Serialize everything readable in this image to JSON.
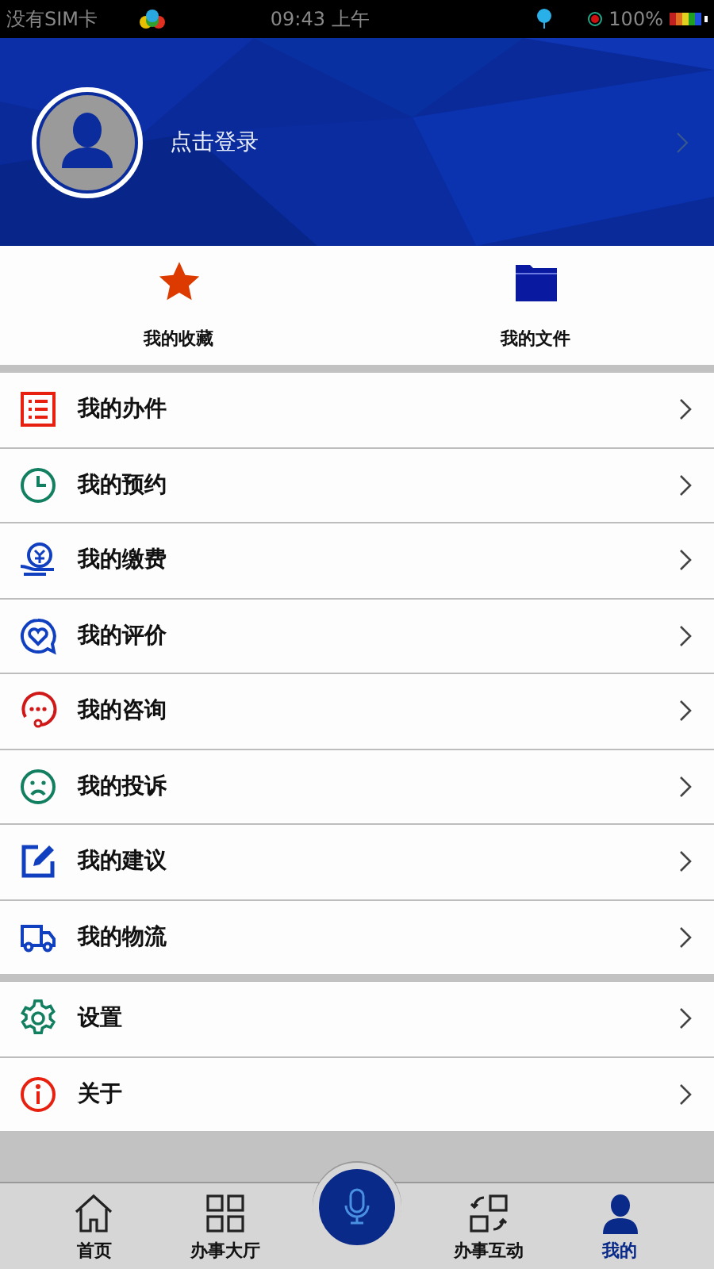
{
  "status_bar": {
    "carrier": "没有SIM卡",
    "time": "09:43 上午",
    "battery": "100%"
  },
  "profile": {
    "login": "点击登录"
  },
  "quick_links": [
    {
      "kind": "star",
      "label": "我的收藏"
    },
    {
      "kind": "folder",
      "label": "我的文件"
    }
  ],
  "menu_groups": [
    [
      {
        "kind": "list",
        "label": "我的办件"
      },
      {
        "kind": "clock",
        "label": "我的预约"
      },
      {
        "kind": "payment",
        "label": "我的缴费"
      },
      {
        "kind": "heart",
        "label": "我的评价"
      },
      {
        "kind": "chat",
        "label": "我的咨询"
      },
      {
        "kind": "sad",
        "label": "我的投诉"
      },
      {
        "kind": "edit",
        "label": "我的建议"
      },
      {
        "kind": "truck",
        "label": "我的物流"
      }
    ],
    [
      {
        "kind": "gear",
        "label": "设置"
      },
      {
        "kind": "info",
        "label": "关于"
      }
    ]
  ],
  "tab_bar": [
    {
      "kind": "home",
      "label": "首页",
      "selected": false
    },
    {
      "kind": "grid",
      "label": "办事大厅",
      "selected": false
    },
    {
      "kind": "mic"
    },
    {
      "kind": "swap",
      "label": "办事互动",
      "selected": false
    },
    {
      "kind": "person",
      "label": "我的",
      "selected": true
    }
  ]
}
